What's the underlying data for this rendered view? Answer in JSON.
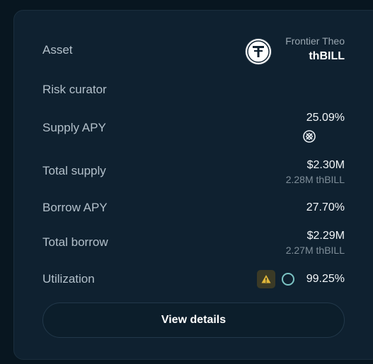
{
  "card": {
    "asset": {
      "label": "Asset",
      "issuer": "Frontier Theo",
      "symbol": "thBILL",
      "icon": "tether-icon"
    },
    "risk_curator": {
      "label": "Risk curator"
    },
    "supply_apy": {
      "label": "Supply APY",
      "value": "25.09%",
      "icon": "rewards-icon"
    },
    "total_supply": {
      "label": "Total supply",
      "value": "$2.30M",
      "sub": "2.28M thBILL"
    },
    "borrow_apy": {
      "label": "Borrow APY",
      "value": "27.70%"
    },
    "total_borrow": {
      "label": "Total borrow",
      "value": "$2.29M",
      "sub": "2.27M thBILL"
    },
    "utilization": {
      "label": "Utilization",
      "value": "99.25%",
      "warning_icon": "warning-icon",
      "ring_icon": "utilization-ring-icon"
    },
    "view_details_label": "View details"
  },
  "colors": {
    "background": "#081620",
    "card": "#0f2130",
    "label": "#b3c0ca",
    "value": "#f2f6f8",
    "warning": "#e0b73a",
    "ring": "#7cc4c4"
  }
}
